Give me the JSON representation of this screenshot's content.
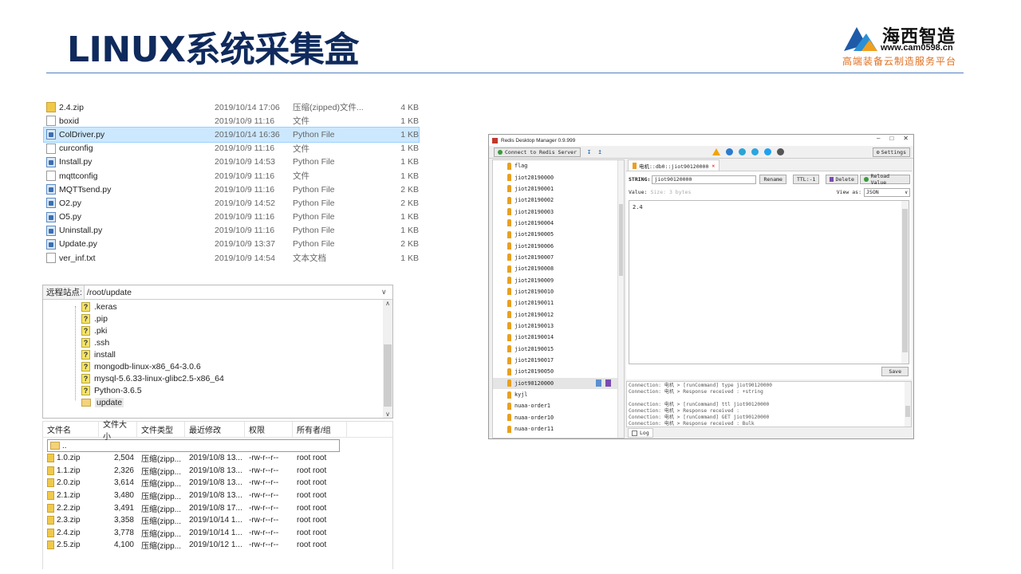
{
  "title": "LINUX系统采集盒",
  "logo": {
    "brand": "海西智造",
    "url": "www.cam0598.cn",
    "slogan": "高端装备云制造服务平台",
    "mark": "CAM"
  },
  "files": [
    {
      "name": "2.4.zip",
      "date": "2019/10/14 17:06",
      "type": "压缩(zipped)文件...",
      "size": "4 KB",
      "icon": "zip"
    },
    {
      "name": "boxid",
      "date": "2019/10/9 11:16",
      "type": "文件",
      "size": "1 KB",
      "icon": "file"
    },
    {
      "name": "ColDriver.py",
      "date": "2019/10/14 16:36",
      "type": "Python File",
      "size": "1 KB",
      "icon": "py"
    },
    {
      "name": "curconfig",
      "date": "2019/10/9 11:16",
      "type": "文件",
      "size": "1 KB",
      "icon": "file"
    },
    {
      "name": "Install.py",
      "date": "2019/10/9 14:53",
      "type": "Python File",
      "size": "1 KB",
      "icon": "py"
    },
    {
      "name": "mqttconfig",
      "date": "2019/10/9 11:16",
      "type": "文件",
      "size": "1 KB",
      "icon": "file"
    },
    {
      "name": "MQTTsend.py",
      "date": "2019/10/9 11:16",
      "type": "Python File",
      "size": "2 KB",
      "icon": "py"
    },
    {
      "name": "O2.py",
      "date": "2019/10/9 14:52",
      "type": "Python File",
      "size": "2 KB",
      "icon": "py"
    },
    {
      "name": "O5.py",
      "date": "2019/10/9 11:16",
      "type": "Python File",
      "size": "1 KB",
      "icon": "py"
    },
    {
      "name": "Uninstall.py",
      "date": "2019/10/9 11:16",
      "type": "Python File",
      "size": "1 KB",
      "icon": "py"
    },
    {
      "name": "Update.py",
      "date": "2019/10/9 13:37",
      "type": "Python File",
      "size": "2 KB",
      "icon": "py"
    },
    {
      "name": "ver_inf.txt",
      "date": "2019/10/9 14:54",
      "type": "文本文档",
      "size": "1 KB",
      "icon": "file"
    }
  ],
  "remote": {
    "label": "远程站点:",
    "path": "/root/update",
    "tree": [
      ".keras",
      ".pip",
      ".pki",
      ".ssh",
      "install",
      "mongodb-linux-x86_64-3.0.6",
      "mysql-5.6.33-linux-glibc2.5-x86_64",
      "Python-3.6.5",
      "update"
    ]
  },
  "rlist": {
    "headers": [
      "文件名",
      "文件大小",
      "文件类型",
      "最近修改",
      "权限",
      "所有者/组"
    ],
    "updir": "..",
    "rows": [
      [
        "1.0.zip",
        "2,504",
        "压缩(zipp...",
        "2019/10/8 13...",
        "-rw-r--r--",
        "root root"
      ],
      [
        "1.1.zip",
        "2,326",
        "压缩(zipp...",
        "2019/10/8 13...",
        "-rw-r--r--",
        "root root"
      ],
      [
        "2.0.zip",
        "3,614",
        "压缩(zipp...",
        "2019/10/8 13...",
        "-rw-r--r--",
        "root root"
      ],
      [
        "2.1.zip",
        "3,480",
        "压缩(zipp...",
        "2019/10/8 13...",
        "-rw-r--r--",
        "root root"
      ],
      [
        "2.2.zip",
        "3,491",
        "压缩(zipp...",
        "2019/10/8 17...",
        "-rw-r--r--",
        "root root"
      ],
      [
        "2.3.zip",
        "3,358",
        "压缩(zipp...",
        "2019/10/14 1...",
        "-rw-r--r--",
        "root root"
      ],
      [
        "2.4.zip",
        "3,778",
        "压缩(zipp...",
        "2019/10/14 1...",
        "-rw-r--r--",
        "root root"
      ],
      [
        "2.5.zip",
        "4,100",
        "压缩(zipp...",
        "2019/10/12 1...",
        "-rw-r--r--",
        "root root"
      ]
    ]
  },
  "rdm": {
    "window_title": "Redis Desktop Manager 0.9.999",
    "connect": "Connect to Redis Server",
    "settings": "Settings",
    "tab": "电机::db0::jiot90120000",
    "string_label": "STRING:",
    "key_name": "jiot90120000",
    "rename": "Rename",
    "ttl": "TTL:-1",
    "delete": "Delete",
    "reload": "Reload Value",
    "value_label": "Value:",
    "size_hint": "Size: 3 bytes",
    "view_as": "View as:",
    "view_mode": "JSON",
    "value": "2.4",
    "save": "Save",
    "log_tab": "Log",
    "keys": [
      "flag",
      "jiot20190000",
      "jiot20190001",
      "jiot20190002",
      "jiot20190003",
      "jiot20190004",
      "jiot20190005",
      "jiot20190006",
      "jiot20190007",
      "jiot20190008",
      "jiot20190009",
      "jiot20190010",
      "jiot20190011",
      "jiot20190012",
      "jiot20190013",
      "jiot20190014",
      "jiot20190015",
      "jiot20190017",
      "jiot20190050",
      "jiot90120000",
      "kyjl",
      "nuaa-order1",
      "nuaa-order10",
      "nuaa-order11"
    ],
    "log_lines": [
      "Connection: 电机 > [runCommand] type jiot90120000",
      "Connection: 电机 > Response received : +string",
      "",
      "Connection: 电机 > [runCommand] ttl jiot90120000",
      "Connection: 电机 > Response received :",
      "Connection: 电机 > [runCommand] GET jiot90120000",
      "Connection: 电机 > Response received : Bulk"
    ]
  }
}
